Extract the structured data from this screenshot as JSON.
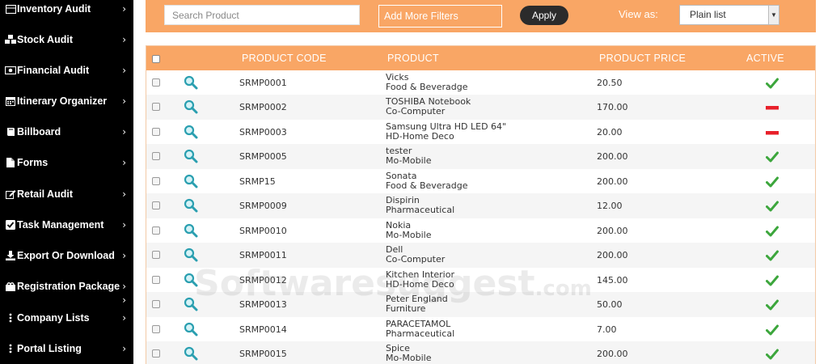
{
  "sidebar": {
    "items": [
      {
        "label": "Inventory Audit",
        "icon": "inventory-icon"
      },
      {
        "label": "Stock Audit",
        "icon": "cubes-icon"
      },
      {
        "label": "Financial Audit",
        "icon": "money-icon"
      },
      {
        "label": "Itinerary Organizer",
        "icon": "calendar-icon"
      },
      {
        "label": "Billboard",
        "icon": "book-icon"
      },
      {
        "label": "Forms",
        "icon": "file-icon"
      },
      {
        "label": "Retail Audit",
        "icon": "edit-icon"
      },
      {
        "label": "Task Management",
        "icon": "check-square-icon"
      },
      {
        "label": "Export Or Download",
        "icon": "download-icon"
      },
      {
        "label": "Registration Package",
        "icon": "package-icon"
      },
      {
        "label": "Company Lists",
        "icon": "vertical-dots-icon"
      },
      {
        "label": "Portal Listing",
        "icon": "vertical-dots-icon"
      }
    ],
    "chevron": "›"
  },
  "filters": {
    "search_placeholder": "Search Product",
    "more_filters_label": "Add More Filters",
    "apply_label": "Apply",
    "view_as_label": "View as:",
    "view_selected": "Plain list"
  },
  "table": {
    "headers": {
      "code": "PRODUCT CODE",
      "product": "PRODUCT",
      "price": "PRODUCT PRICE",
      "active": "ACTIVE"
    },
    "rows": [
      {
        "code": "SRMP0001",
        "name": "Vicks",
        "category": "Food & Beveradge",
        "price": "20.50",
        "active": true
      },
      {
        "code": "SRMP0002",
        "name": "TOSHIBA Notebook",
        "category": "Co-Computer",
        "price": "170.00",
        "active": false
      },
      {
        "code": "SRMP0003",
        "name": "Samsung Ultra HD LED 64\"",
        "category": "HD-Home Deco",
        "price": "20.00",
        "active": false
      },
      {
        "code": "SRMP0005",
        "name": "tester",
        "category": "Mo-Mobile",
        "price": "200.00",
        "active": true
      },
      {
        "code": "SRMP15",
        "name": "Sonata",
        "category": "Food & Beveradge",
        "price": "200.00",
        "active": true
      },
      {
        "code": "SRMP0009",
        "name": "Dispirin",
        "category": "Pharmaceutical",
        "price": "12.00",
        "active": true
      },
      {
        "code": "SRMP0010",
        "name": "Nokia",
        "category": "Mo-Mobile",
        "price": "200.00",
        "active": true
      },
      {
        "code": "SRMP0011",
        "name": "Dell",
        "category": "Co-Computer",
        "price": "200.00",
        "active": true
      },
      {
        "code": "SRMP0012",
        "name": "Kitchen Interior",
        "category": "HD-Home Deco",
        "price": "145.00",
        "active": true
      },
      {
        "code": "SRMP0013",
        "name": "Peter England",
        "category": "Furniture",
        "price": "50.00",
        "active": true
      },
      {
        "code": "SRMP0014",
        "name": "PARACETAMOL",
        "category": "Pharmaceutical",
        "price": "7.00",
        "active": true
      },
      {
        "code": "SRMP0015",
        "name": "Spice",
        "category": "Mo-Mobile",
        "price": "200.00",
        "active": true
      }
    ]
  },
  "watermark": {
    "main": "Softwaresuggest",
    "suffix": ".com"
  },
  "colors": {
    "accent": "#f9a665",
    "sidebar_bg": "#000000",
    "active_green": "#3ca63c",
    "inactive_red": "#e8202a",
    "icon_teal": "#2a9fb0"
  }
}
